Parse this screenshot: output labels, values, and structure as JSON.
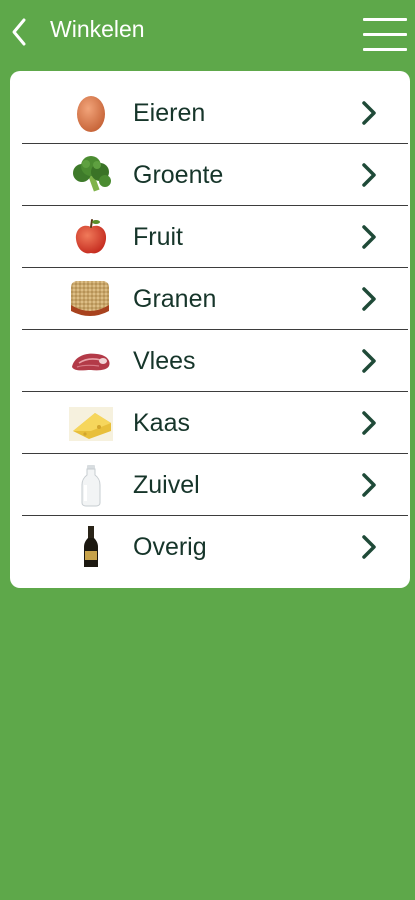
{
  "colors": {
    "background": "#5ea84a",
    "card": "#ffffff",
    "label_text": "#16352a",
    "chevron": "#1f4a38"
  },
  "header": {
    "title": "Winkelen",
    "back_icon": "chevron-left-icon",
    "menu_icon": "hamburger-menu-icon"
  },
  "categories": [
    {
      "label": "Eieren",
      "icon": "egg-icon"
    },
    {
      "label": "Groente",
      "icon": "broccoli-icon"
    },
    {
      "label": "Fruit",
      "icon": "apple-icon"
    },
    {
      "label": "Granen",
      "icon": "grain-bowl-icon"
    },
    {
      "label": "Vlees",
      "icon": "meat-icon"
    },
    {
      "label": "Kaas",
      "icon": "cheese-icon"
    },
    {
      "label": "Zuivel",
      "icon": "milk-bottle-icon"
    },
    {
      "label": "Overig",
      "icon": "bottle-icon"
    }
  ]
}
